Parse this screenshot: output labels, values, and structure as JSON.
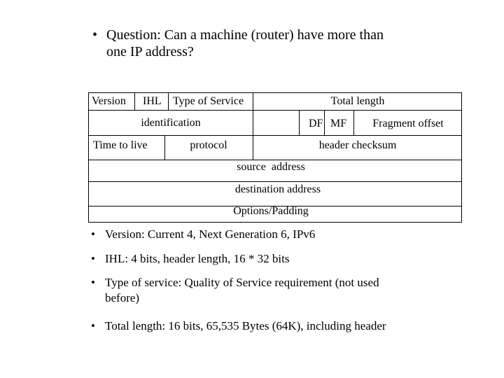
{
  "question": {
    "bullet": "•",
    "text_line1": "Question: Can a machine (router) have more than",
    "text_line2": "one IP address?"
  },
  "table": {
    "version": "Version",
    "ihl": "IHL",
    "type_of_service": "Type of Service",
    "total_length": "Total length",
    "identification": "identification",
    "df": "DF",
    "mf": "MF",
    "fragment_offset": "Fragment offset",
    "time_to_live": "Time to live",
    "protocol": "protocol",
    "header_checksum": "header checksum",
    "source_address": "source  address",
    "destination_address": "destination address",
    "options_padding": "Options/Padding"
  },
  "notes": [
    {
      "bullet": "•",
      "line1": "Version: Current 4, Next Generation 6, IPv6"
    },
    {
      "bullet": "•",
      "line1": "IHL: 4 bits, header length, 16 * 32 bits"
    },
    {
      "bullet": "•",
      "line1": "Type of service: Quality of Service requirement (not used",
      "line2": "before)"
    },
    {
      "bullet": "•",
      "line1": "Total length: 16 bits, 65,535 Bytes (64K), including header"
    }
  ]
}
